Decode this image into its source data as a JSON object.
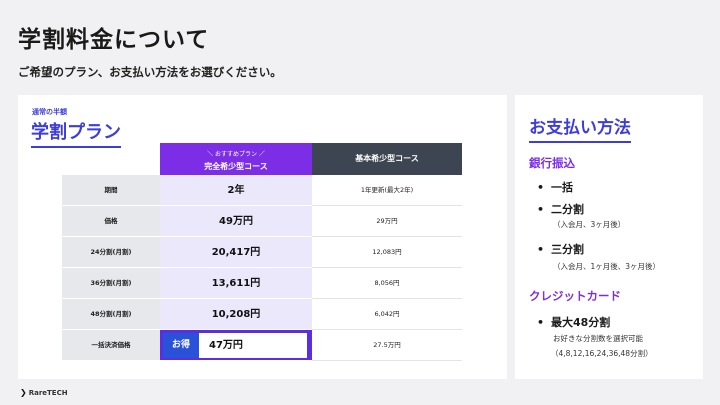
{
  "header": {
    "title": "学割料金について",
    "subtitle": "ご希望のプラン、お支払い方法をお選びください。"
  },
  "plan_panel": {
    "kicker": "通常の半額",
    "title": "学割プラン",
    "columns": {
      "recommend_tag": "＼ おすすめプラン ／",
      "recommend_name": "完全希少型コース",
      "basic_name": "基本希少型コース"
    },
    "rows": [
      {
        "label": "期間",
        "recommend": "2年",
        "basic": "1年更新(最大2年)"
      },
      {
        "label": "価格",
        "recommend": "49万円",
        "basic": "29万円"
      },
      {
        "label": "24分割(月割)",
        "recommend": "20,417円",
        "basic": "12,083円"
      },
      {
        "label": "36分割(月割)",
        "recommend": "13,611円",
        "basic": "8,056円"
      },
      {
        "label": "48分割(月割)",
        "recommend": "10,208円",
        "basic": "6,042円"
      },
      {
        "label": "一括決済価格",
        "badge": "お得",
        "recommend": "47万円",
        "basic": "27.5万円"
      }
    ]
  },
  "payment_panel": {
    "title": "お支払い方法",
    "bank": {
      "heading": "銀行振込",
      "items": [
        {
          "label": "一括",
          "note": ""
        },
        {
          "label": "二分割",
          "note": "（入会月、3ヶ月後）"
        },
        {
          "label": "三分割",
          "note": "（入会月、1ヶ月後、3ヶ月後）"
        }
      ]
    },
    "card": {
      "heading": "クレジットカード",
      "items": [
        {
          "label": "最大48分割",
          "note": "お好きな分割数を選択可能",
          "note2": "（4,8,12,16,24,36,48分割）"
        }
      ]
    }
  },
  "footer": {
    "brand": "RareTECH"
  },
  "colors": {
    "accent_blue": "#3d3dd9",
    "accent_purple": "#7b2ee6",
    "header_dark": "#3c4551"
  }
}
